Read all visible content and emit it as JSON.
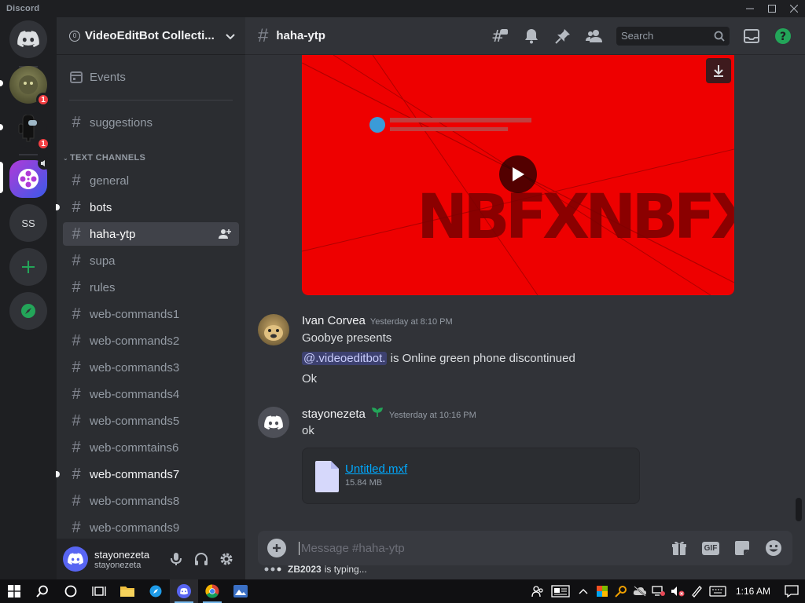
{
  "window": {
    "title": "Discord",
    "controls": [
      "minimize",
      "maximize",
      "close"
    ]
  },
  "servers": [
    {
      "name": "home",
      "icon": "discord-logo-icon"
    },
    {
      "name": "server-1",
      "badge": "1"
    },
    {
      "name": "server-2",
      "badge": "1"
    },
    {
      "name": "server-3-active"
    },
    {
      "name": "server-ss",
      "label": "SS"
    },
    {
      "name": "add-server",
      "icon": "plus-icon"
    },
    {
      "name": "explore",
      "icon": "compass-icon"
    }
  ],
  "guild": {
    "name": "VideoEditBot Collecti...",
    "boost": "0"
  },
  "sidebar": {
    "events_label": "Events",
    "suggestions_label": "suggestions",
    "category_label": "TEXT CHANNELS",
    "channels": [
      {
        "name": "general",
        "state": "normal",
        "locked": true
      },
      {
        "name": "bots",
        "state": "unread"
      },
      {
        "name": "haha-ytp",
        "state": "active"
      },
      {
        "name": "supa",
        "state": "normal"
      },
      {
        "name": "rules",
        "state": "normal"
      },
      {
        "name": "web-commands1",
        "state": "normal"
      },
      {
        "name": "web-commands2",
        "state": "normal"
      },
      {
        "name": "web-commands3",
        "state": "normal"
      },
      {
        "name": "web-commands4",
        "state": "normal"
      },
      {
        "name": "web-commands5",
        "state": "normal"
      },
      {
        "name": "web-commtains6",
        "state": "normal"
      },
      {
        "name": "web-commands7",
        "state": "unread"
      },
      {
        "name": "web-commands8",
        "state": "normal"
      },
      {
        "name": "web-commands9",
        "state": "normal"
      }
    ]
  },
  "user": {
    "name": "stayonezeta",
    "tag": "stayonezeta"
  },
  "channel_header": {
    "name": "haha-ytp",
    "search_placeholder": "Search"
  },
  "video": {
    "logo_text": "NBFXNBFX"
  },
  "messages": [
    {
      "author": "Ivan Corvea",
      "time": "Yesterday at 8:10 PM",
      "lines": [
        "Goobye presents",
        "is Online green phone discontinued",
        "Ok"
      ],
      "mention": "@.videoeditbot."
    },
    {
      "author": "stayonezeta",
      "time": "Yesterday at 10:16 PM",
      "lines": [
        "ok"
      ],
      "attachment": {
        "filename": "Untitled.mxf",
        "size": "15.84 MB"
      }
    }
  ],
  "composer": {
    "placeholder": "Message #haha-ytp",
    "gif_label": "GIF"
  },
  "typing": {
    "user": "ZB2023",
    "text": "is typing..."
  },
  "taskbar": {
    "time": "1:16 AM"
  },
  "colors": {
    "accent": "#5865f2",
    "red": "#f23f43",
    "green": "#23a559",
    "link": "#00a8fc"
  }
}
